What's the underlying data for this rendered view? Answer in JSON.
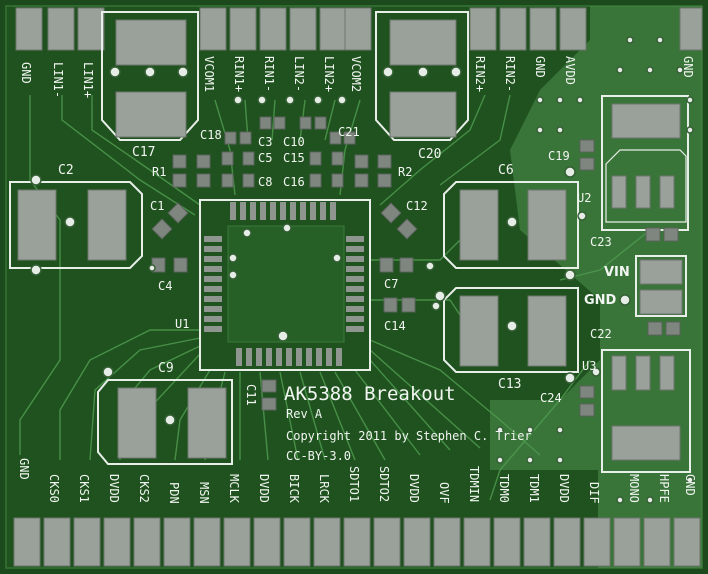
{
  "board": {
    "title": "AK5388 Breakout",
    "revision": "Rev A",
    "copyright": "Copyright 2011 by Stephen C. Trier",
    "license": "CC-BY-3.0"
  },
  "top_pins": [
    "GND",
    "LIN1-",
    "LIN1+",
    "VCOM1",
    "RIN1+",
    "RIN1-",
    "LIN2-",
    "LIN2+",
    "VCOM2",
    "RIN2+",
    "RIN2-",
    "GND",
    "AVDD",
    "GND"
  ],
  "bottom_pins": [
    "GND",
    "CKS0",
    "CKS1",
    "DVDD",
    "CKS2",
    "PDN",
    "MSN",
    "MCLK",
    "DVDD",
    "BICK",
    "LRCK",
    "SDTO1",
    "SDTO2",
    "DVDD",
    "OVF",
    "TDMIN",
    "TDM0",
    "TDM1",
    "DVDD",
    "DIF",
    "MONO",
    "HPFE",
    "GND"
  ],
  "components": {
    "c17": "C17",
    "c20": "C20",
    "c18": "C18",
    "c3": "C3",
    "c10": "C10",
    "c21": "C21",
    "c5": "C5",
    "c15": "C15",
    "r1": "R1",
    "r2": "R2",
    "c8": "C8",
    "c16": "C16",
    "c2": "C2",
    "c6": "C6",
    "c1": "C1",
    "c12": "C12",
    "c4": "C4",
    "c7": "C7",
    "c14": "C14",
    "u1": "U1",
    "c9": "C9",
    "c11": "C11",
    "c13": "C13",
    "c19": "C19",
    "u2": "U2",
    "c23": "C23",
    "c22": "C22",
    "u3": "U3",
    "c24": "C24"
  },
  "power_labels": {
    "vin": "VIN",
    "gnd": "GND"
  }
}
